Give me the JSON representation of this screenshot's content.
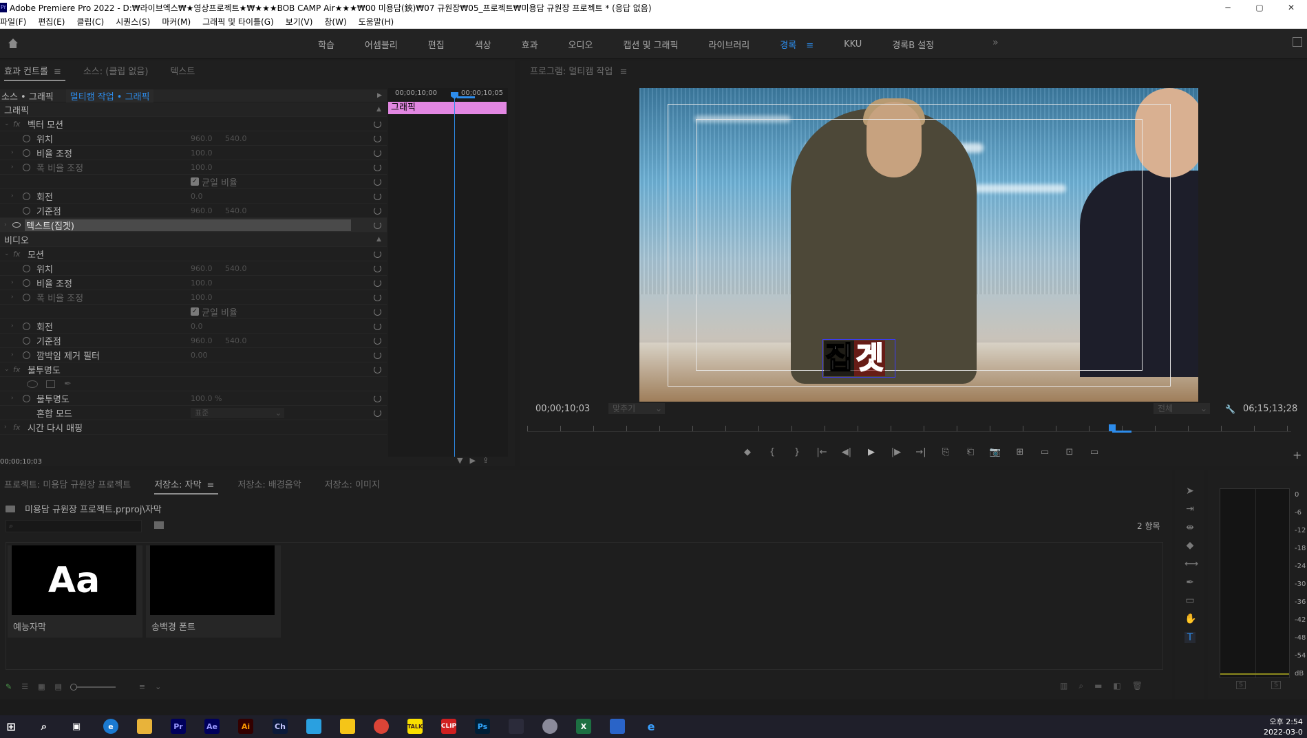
{
  "window": {
    "title": "Adobe Premiere Pro 2022 - D:₩라이브엑스₩★영상프로젝트★₩★★★BOB CAMP Air★★★₩00 미용담(鋏)₩07 규원장₩05_프로젝트₩미용담 규원장 프로젝트 * (응답 없음)",
    "app_icon": "Pr",
    "minimize": "─",
    "maximize": "▢",
    "close": "✕"
  },
  "menu": [
    "파일(F)",
    "편집(E)",
    "클립(C)",
    "시퀀스(S)",
    "마커(M)",
    "그래픽 및 타이틀(G)",
    "보기(V)",
    "창(W)",
    "도움말(H)"
  ],
  "workspace": {
    "tabs": [
      {
        "label": "학습",
        "active": false
      },
      {
        "label": "어셈블리",
        "active": false
      },
      {
        "label": "편집",
        "active": false
      },
      {
        "label": "색상",
        "active": false
      },
      {
        "label": "효과",
        "active": false
      },
      {
        "label": "오디오",
        "active": false
      },
      {
        "label": "캡션 및 그래픽",
        "active": false
      },
      {
        "label": "라이브러리",
        "active": false
      },
      {
        "label": "경록",
        "active": true
      },
      {
        "label": "KKU",
        "active": false
      },
      {
        "label": "경록B 설정",
        "active": false
      }
    ],
    "active_menu": "≡",
    "more": "»"
  },
  "effect_controls": {
    "tabs": [
      {
        "label": "효과 컨트롤",
        "active": true,
        "menu": "≡"
      },
      {
        "label": "소스: (클립 없음)",
        "active": false
      },
      {
        "label": "텍스트",
        "active": false
      }
    ],
    "source_label": "소스 • 그래픽",
    "sequence_label": "멀티캠 작업 • 그래픽",
    "ruler": [
      "00;00;10;00",
      "00;00;10;05"
    ],
    "clip_label": "그래픽",
    "timecode": "00;00;10;03",
    "sections": {
      "graphic": "그래픽",
      "video": "비디오"
    },
    "rows": {
      "vector_motion": "벡터 모션",
      "position": {
        "label": "위치",
        "x": "960.0",
        "y": "540.0"
      },
      "scale": {
        "label": "비율 조정",
        "value": "100.0"
      },
      "scale_width": {
        "label": "폭 비율 조정",
        "value": "100.0"
      },
      "uniform_scale": "균일 비율",
      "rotation": {
        "label": "회전",
        "value": "0.0"
      },
      "anchor": {
        "label": "기준점",
        "x": "960.0",
        "y": "540.0"
      },
      "text_layer": "텍스트(집겟)",
      "motion": "모션",
      "position2": {
        "label": "위치",
        "x": "960.0",
        "y": "540.0"
      },
      "scale2": {
        "label": "비율 조정",
        "value": "100.0"
      },
      "scale_width2": {
        "label": "폭 비율 조정",
        "value": "100.0"
      },
      "uniform_scale2": "균일 비율",
      "rotation2": {
        "label": "회전",
        "value": "0.0"
      },
      "anchor2": {
        "label": "기준점",
        "x": "960.0",
        "y": "540.0"
      },
      "flicker": {
        "label": "깜박임 제거 필터",
        "value": "0.00"
      },
      "opacity_section": "불투명도",
      "opacity": {
        "label": "불투명도",
        "value": "100.0 %"
      },
      "blend": {
        "label": "혼합 모드",
        "value": "표준"
      },
      "time_remap": "시간 다시 매핑"
    }
  },
  "program_monitor": {
    "title": "프로그램: 멀티캠 작업",
    "menu": "≡",
    "timecode_left": "00;00;10;03",
    "fit": "맞추기",
    "quality": "전체",
    "timecode_right": "06;15;13;28",
    "caption_char1": "집",
    "caption_char2": "겟",
    "transport": [
      "◆",
      "{",
      "}",
      "|←",
      "◀|",
      "▶",
      "|▶",
      "→|",
      "⎘",
      "⎗",
      "📷",
      "⊞",
      "▭",
      "⊡",
      "▭"
    ],
    "add": "+"
  },
  "project": {
    "tabs": [
      {
        "label": "프로젝트: 미용담 규원장 프로젝트",
        "active": false
      },
      {
        "label": "저장소: 자막",
        "active": true,
        "menu": "≡"
      },
      {
        "label": "저장소: 배경음악",
        "active": false
      },
      {
        "label": "저장소: 이미지",
        "active": false
      }
    ],
    "path": "미용담 규원장 프로젝트.prproj\\자막",
    "count": "2 항목",
    "items": [
      {
        "thumb": "Aa",
        "label": "예능자막"
      },
      {
        "thumb": "",
        "label": "송백경 폰트"
      }
    ]
  },
  "meter": {
    "db_labels": [
      "0",
      "-6",
      "-12",
      "-18",
      "-24",
      "-30",
      "-36",
      "-42",
      "-48",
      "-54",
      "dB"
    ],
    "solo": [
      "S",
      "S"
    ]
  },
  "taskbar": {
    "apps": [
      "Pr",
      "Ae",
      "Ai",
      "Ch",
      "Ps",
      "CLIP",
      "X"
    ],
    "time": "오후 2:54",
    "date": "2022-03-0"
  },
  "colors": {
    "accent": "#2d8ceb",
    "clip": "#e287e2",
    "panel_bg": "#1e1e1e"
  }
}
